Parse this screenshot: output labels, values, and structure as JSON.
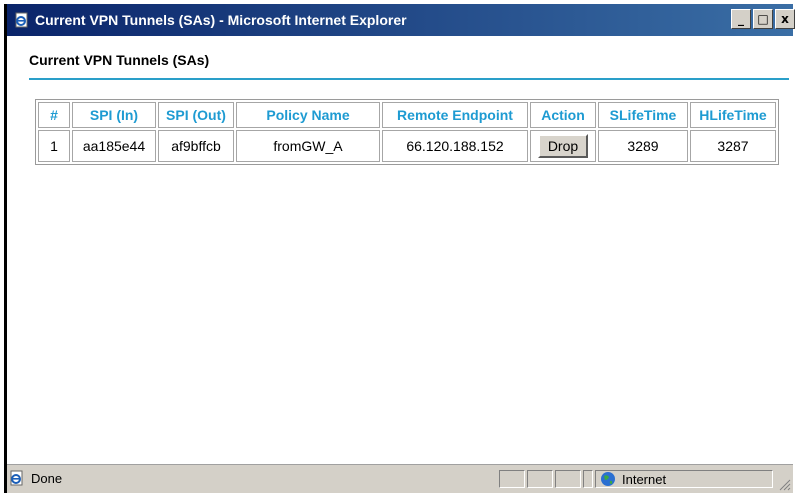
{
  "window": {
    "title": "Current VPN Tunnels (SAs) - Microsoft Internet Explorer",
    "buttons": {
      "minimize": "_",
      "maximize": "□",
      "close": "x"
    }
  },
  "page": {
    "heading": "Current VPN Tunnels (SAs)"
  },
  "table": {
    "headers": [
      "#",
      "SPI (In)",
      "SPI (Out)",
      "Policy Name",
      "Remote Endpoint",
      "Action",
      "SLifeTime",
      "HLifeTime"
    ],
    "rows": [
      {
        "num": "1",
        "spi_in": "aa185e44",
        "spi_out": "af9bffcb",
        "policy": "fromGW_A",
        "endpoint": "66.120.188.152",
        "action": "Drop",
        "slife": "3289",
        "hlife": "3287"
      }
    ]
  },
  "statusbar": {
    "status": "Done",
    "zone": "Internet"
  },
  "colors": {
    "titlebar": "#0a246a",
    "header_text": "#1e9bd2",
    "rule": "#2a9fc9"
  },
  "icons": {
    "title": "ie-page-icon",
    "status": "ie-page-icon",
    "zone": "globe-icon"
  }
}
